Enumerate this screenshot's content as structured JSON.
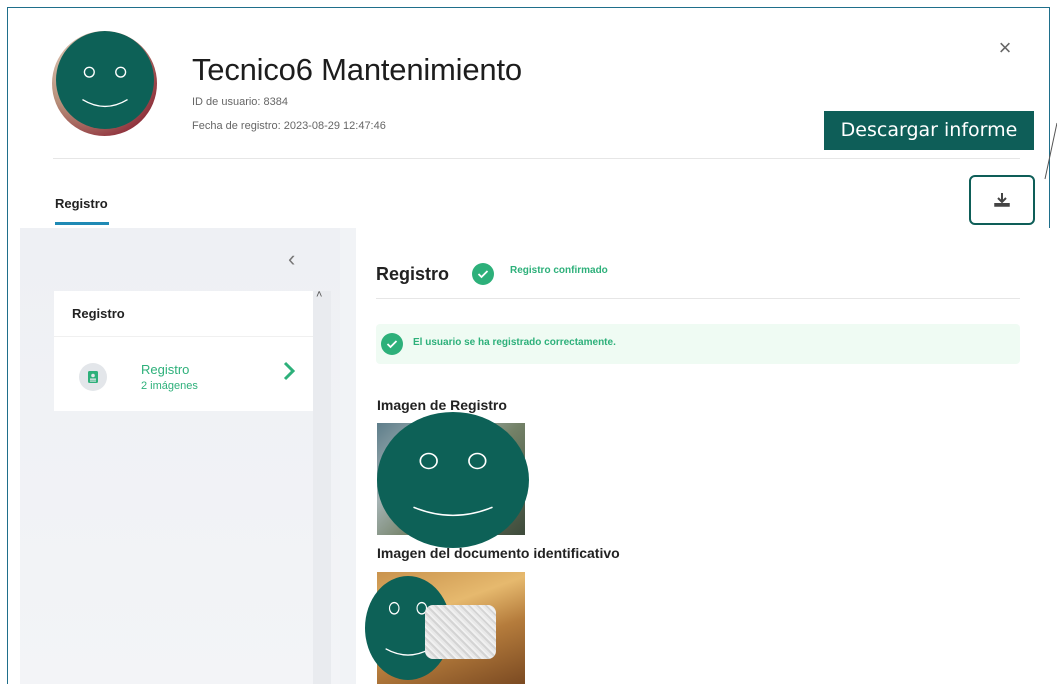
{
  "header": {
    "user_name": "Tecnico6 Mantenimiento",
    "user_id": "ID de usuario: 8384",
    "registration_date": "Fecha de registro: 2023-08-29 12:47:46",
    "close_icon": "close-icon",
    "close_glyph": "×"
  },
  "callout": {
    "label": "Descargar informe"
  },
  "tabs": [
    {
      "label": "Registro",
      "active": true
    }
  ],
  "sidebar": {
    "title": "Registro",
    "collapse_glyph": "‹",
    "scroll_up_glyph": "˄",
    "items": [
      {
        "label": "Registro",
        "sublabel": "2 imágenes",
        "icon": "id-card-icon"
      }
    ]
  },
  "main": {
    "title": "Registro",
    "status": "Registro confirmado",
    "banner": "El usuario se ha registrado correctamente.",
    "sections": [
      {
        "title": "Imagen de Registro"
      },
      {
        "title": "Imagen del documento identificativo"
      }
    ]
  },
  "colors": {
    "accent_green": "#2db07a",
    "brand_dark_green": "#0e5e58",
    "tab_underline": "#1f8ab5",
    "frame_border": "#1f6f8b"
  }
}
